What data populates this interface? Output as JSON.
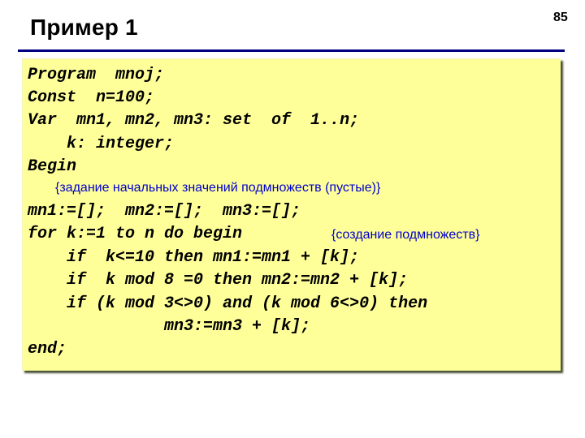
{
  "slide": {
    "title": "Пример 1",
    "page_number": "85"
  },
  "code": {
    "lines": [
      {
        "text": "Program  mnoj;"
      },
      {
        "text": "Const  n=100;"
      },
      {
        "text": "Var  mn1, mn2, mn3: set  of  1..n;"
      },
      {
        "text": "    k: integer;"
      },
      {
        "text": "Begin"
      },
      {
        "comment": "{задание начальных значений подмножеств (пустые)}"
      },
      {
        "text": "mn1:=[];  mn2:=[];  mn3:=[];"
      },
      {
        "text": "for k:=1 to n do begin",
        "comment": "{создание подмножеств}"
      },
      {
        "text": "    if  k<=10 then mn1:=mn1 + [k];"
      },
      {
        "text": "    if  k mod 8 =0 then mn2:=mn2 + [k];"
      },
      {
        "text": "    if (k mod 3<>0) and (k mod 6<>0) then"
      },
      {
        "text": "              mn3:=mn3 + [k];"
      },
      {
        "text": "end;"
      }
    ]
  },
  "colors": {
    "box_background": "#FFFF99",
    "rule": "#000080",
    "comment": "#0000CC",
    "code": "#000000"
  }
}
